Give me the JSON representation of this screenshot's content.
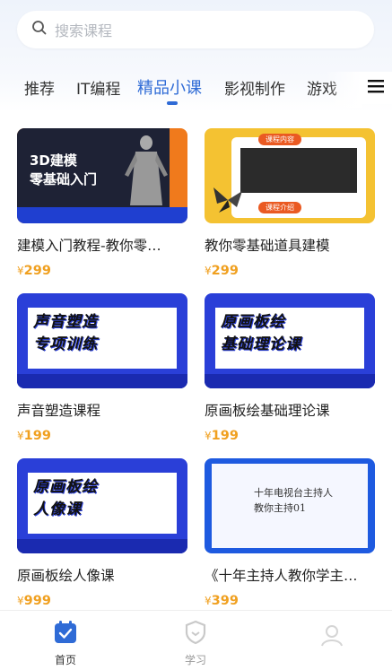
{
  "search": {
    "placeholder": "搜索课程"
  },
  "tabs": [
    {
      "label": "推荐"
    },
    {
      "label": "IT编程"
    },
    {
      "label": "精品小课"
    },
    {
      "label": "影视制作"
    },
    {
      "label": "游戏"
    }
  ],
  "active_tab": "精品小课",
  "courses": [
    {
      "title": "建模入门教程-教你零…",
      "price": "299",
      "thumb_text": [
        "3D建模",
        "零基础入门"
      ]
    },
    {
      "title": "教你零基础道具建模",
      "price": "299",
      "thumb_text": [
        "课程内容",
        "课程介绍"
      ]
    },
    {
      "title": "声音塑造课程",
      "price": "199",
      "thumb_text": [
        "声音塑造",
        "专项训练"
      ]
    },
    {
      "title": "原画板绘基础理论课",
      "price": "199",
      "thumb_text": [
        "原画板绘",
        "基础理论课"
      ]
    },
    {
      "title": "原画板绘人像课",
      "price": "999",
      "thumb_text": [
        "原画板绘",
        "人像课"
      ]
    },
    {
      "title": "《十年主持人教你学主…",
      "price": "399",
      "thumb_text": [
        "十年电视台主持人",
        "教你主持01"
      ]
    }
  ],
  "currency": "¥",
  "tabbar": {
    "home": "首页",
    "study": "学习"
  },
  "colors": {
    "accent": "#2f6bd6",
    "price": "#f0a020"
  },
  "icons": {
    "search": "search-icon",
    "menu": "menu-icon",
    "home": "calendar-check-icon",
    "study": "shield-icon"
  }
}
